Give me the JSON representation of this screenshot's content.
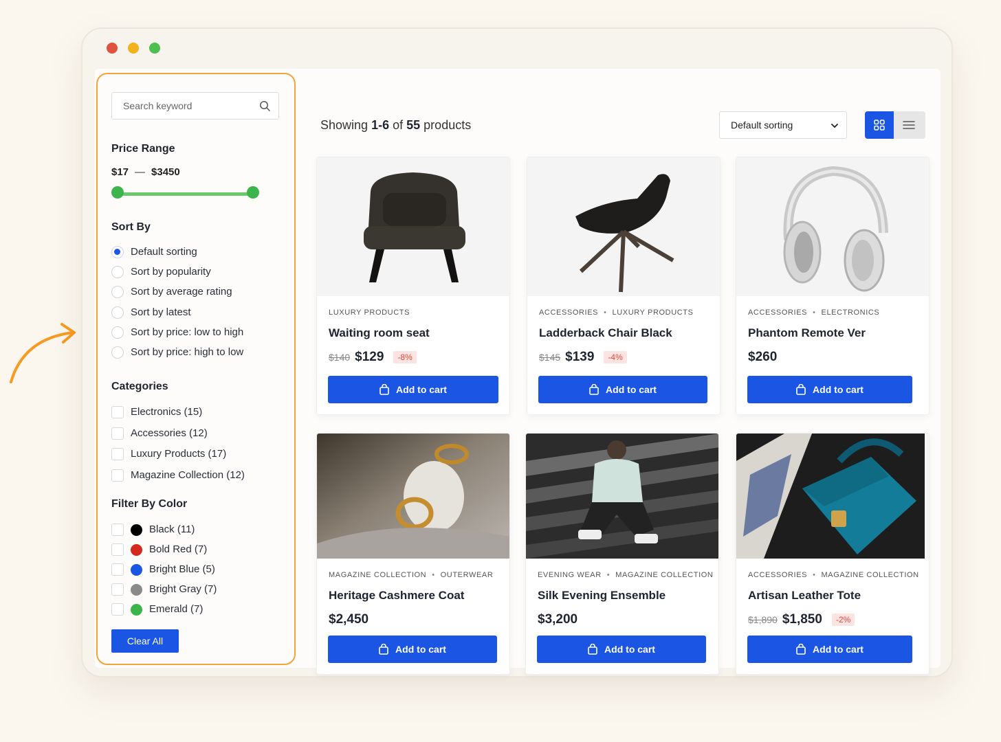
{
  "window": {
    "controls": [
      "close",
      "minimize",
      "maximize"
    ]
  },
  "search": {
    "placeholder": "Search keyword",
    "icon": "search-icon"
  },
  "price_range": {
    "title": "Price Range",
    "min": "$17",
    "separator": "—",
    "max": "$3450"
  },
  "sort_by": {
    "title": "Sort By",
    "options": [
      {
        "label": "Default sorting",
        "selected": true
      },
      {
        "label": "Sort by popularity",
        "selected": false
      },
      {
        "label": "Sort by average rating",
        "selected": false
      },
      {
        "label": "Sort by latest",
        "selected": false
      },
      {
        "label": "Sort by price: low to high",
        "selected": false
      },
      {
        "label": "Sort by price: high to low",
        "selected": false
      }
    ]
  },
  "categories": {
    "title": "Categories",
    "items": [
      {
        "label": "Electronics (15)"
      },
      {
        "label": "Accessories (12)"
      },
      {
        "label": "Luxury Products (17)"
      },
      {
        "label": "Magazine Collection (12)"
      }
    ]
  },
  "colors": {
    "title": "Filter By Color",
    "items": [
      {
        "label": "Black (11)",
        "color": "#000000"
      },
      {
        "label": "Bold Red (7)",
        "color": "#d42a1e"
      },
      {
        "label": "Bright Blue (5)",
        "color": "#1a55e3"
      },
      {
        "label": "Bright Gray (7)",
        "color": "#8a8a8a"
      },
      {
        "label": "Emerald (7)",
        "color": "#3db34b"
      }
    ]
  },
  "clear_all": "Clear All",
  "toolbar": {
    "showing_prefix": "Showing",
    "showing_range": "1-6",
    "showing_of": "of",
    "showing_total": "55",
    "showing_suffix": "products",
    "sort_value": "Default sorting"
  },
  "products": [
    {
      "cats": [
        "LUXURY PRODUCTS"
      ],
      "name": "Waiting room seat",
      "old": "$140",
      "price": "$129",
      "discount": "-8%",
      "cta": "Add to cart"
    },
    {
      "cats": [
        "ACCESSORIES",
        "LUXURY PRODUCTS"
      ],
      "name": "Ladderback Chair Black",
      "old": "$145",
      "price": "$139",
      "discount": "-4%",
      "cta": "Add to cart"
    },
    {
      "cats": [
        "ACCESSORIES",
        "ELECTRONICS"
      ],
      "name": "Phantom Remote Ver",
      "old": "",
      "price": "$260",
      "discount": "",
      "cta": "Add to cart"
    },
    {
      "cats": [
        "MAGAZINE COLLECTION",
        "OUTERWEAR"
      ],
      "name": "Heritage Cashmere Coat",
      "old": "",
      "price": "$2,450",
      "discount": "",
      "cta": "Add to cart"
    },
    {
      "cats": [
        "EVENING WEAR",
        "MAGAZINE COLLECTION"
      ],
      "name": "Silk Evening Ensemble",
      "old": "",
      "price": "$3,200",
      "discount": "",
      "cta": "Add to cart"
    },
    {
      "cats": [
        "ACCESSORIES",
        "MAGAZINE COLLECTION"
      ],
      "name": "Artisan Leather Tote",
      "old": "$1,890",
      "price": "$1,850",
      "discount": "-2%",
      "cta": "Add to cart"
    }
  ],
  "accent": "#1a55e3",
  "highlight": "#f4a23a"
}
